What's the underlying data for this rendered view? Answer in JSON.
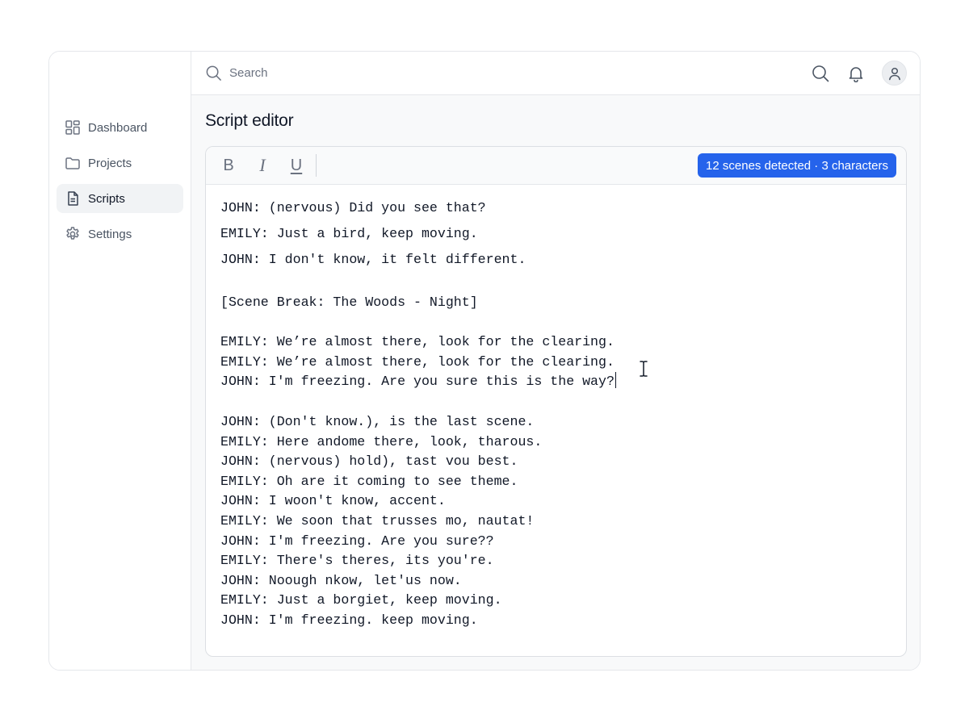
{
  "sidebar": {
    "items": [
      {
        "label": "Dashboard",
        "icon": "dashboard-icon",
        "active": false
      },
      {
        "label": "Projects",
        "icon": "folder-icon",
        "active": false
      },
      {
        "label": "Scripts",
        "icon": "document-icon",
        "active": true
      },
      {
        "label": "Settings",
        "icon": "gear-icon",
        "active": false
      }
    ]
  },
  "topbar": {
    "search_placeholder": "Search",
    "search_value": ""
  },
  "page": {
    "title": "Script editor"
  },
  "editor": {
    "toolbar": {
      "bold_label": "B",
      "italic_label": "I",
      "underline_label": "U"
    },
    "badge": "12 scenes detected · 3 characters",
    "lines": [
      "JOHN: (nervous) Did you see that?",
      "EMILY: Just a bird, keep moving.",
      "JOHN: I don't know, it felt different.",
      "[Scene Break: The Woods - Night]",
      "EMILY: We’re almost there, look for the clearing.",
      "EMILY: We’re almost there, look for the clearing.",
      "JOHN: I'm freezing. Are you sure this is the way?",
      "JOHN: (Don't know.), is the last scene.",
      "EMILY: Here andome there, look, tharous.",
      "JOHN: (nervous) hold), tast vou best.",
      "EMILY: Oh are it coming to see theme.",
      "JOHN: I woon't know, accent.",
      "EMILY: We soon that trusses mo, nautat!",
      "JOHN: I'm freezing. Are you sure??",
      "EMILY: There's theres, its you're.",
      "JOHN: Noough nkow, let'us now.",
      "EMILY: Just a borgiet, keep moving.",
      "JOHN: I'm freezing. keep moving."
    ]
  },
  "colors": {
    "accent": "#2563eb",
    "sidebar_active_bg": "#f1f3f5",
    "border": "#e5e7eb"
  }
}
